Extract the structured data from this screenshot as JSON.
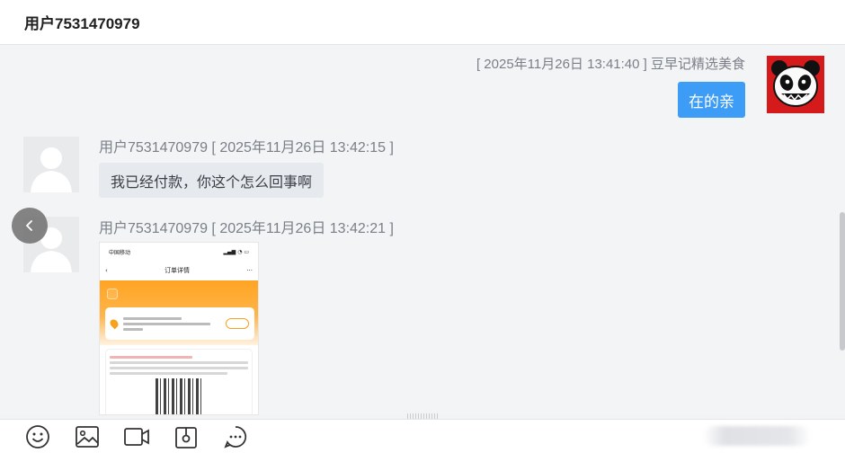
{
  "header": {
    "title": "用户7531470979"
  },
  "messages": [
    {
      "direction": "out",
      "meta": "[ 2025年11月26日 13:41:40 ] 豆早记精选美食",
      "text": "在的亲"
    },
    {
      "direction": "in",
      "meta": "用户7531470979 [ 2025年11月26日 13:42:15 ]",
      "text": "我已经付款，你这个怎么回事啊"
    },
    {
      "direction": "in",
      "meta": "用户7531470979 [ 2025年11月26日 13:42:21 ]",
      "attachment": "image"
    }
  ],
  "screenshot_attachment": {
    "carrier": "中国移动",
    "page_title": "订单详情"
  },
  "toolbar": {
    "tools": [
      "emoji-icon",
      "image-icon",
      "video-icon",
      "file-icon",
      "quick-reply-icon"
    ]
  },
  "colors": {
    "outgoing_bubble": "#3d9cf5",
    "incoming_bubble": "#e6e9ed",
    "panda_bg": "#d51a1c"
  }
}
